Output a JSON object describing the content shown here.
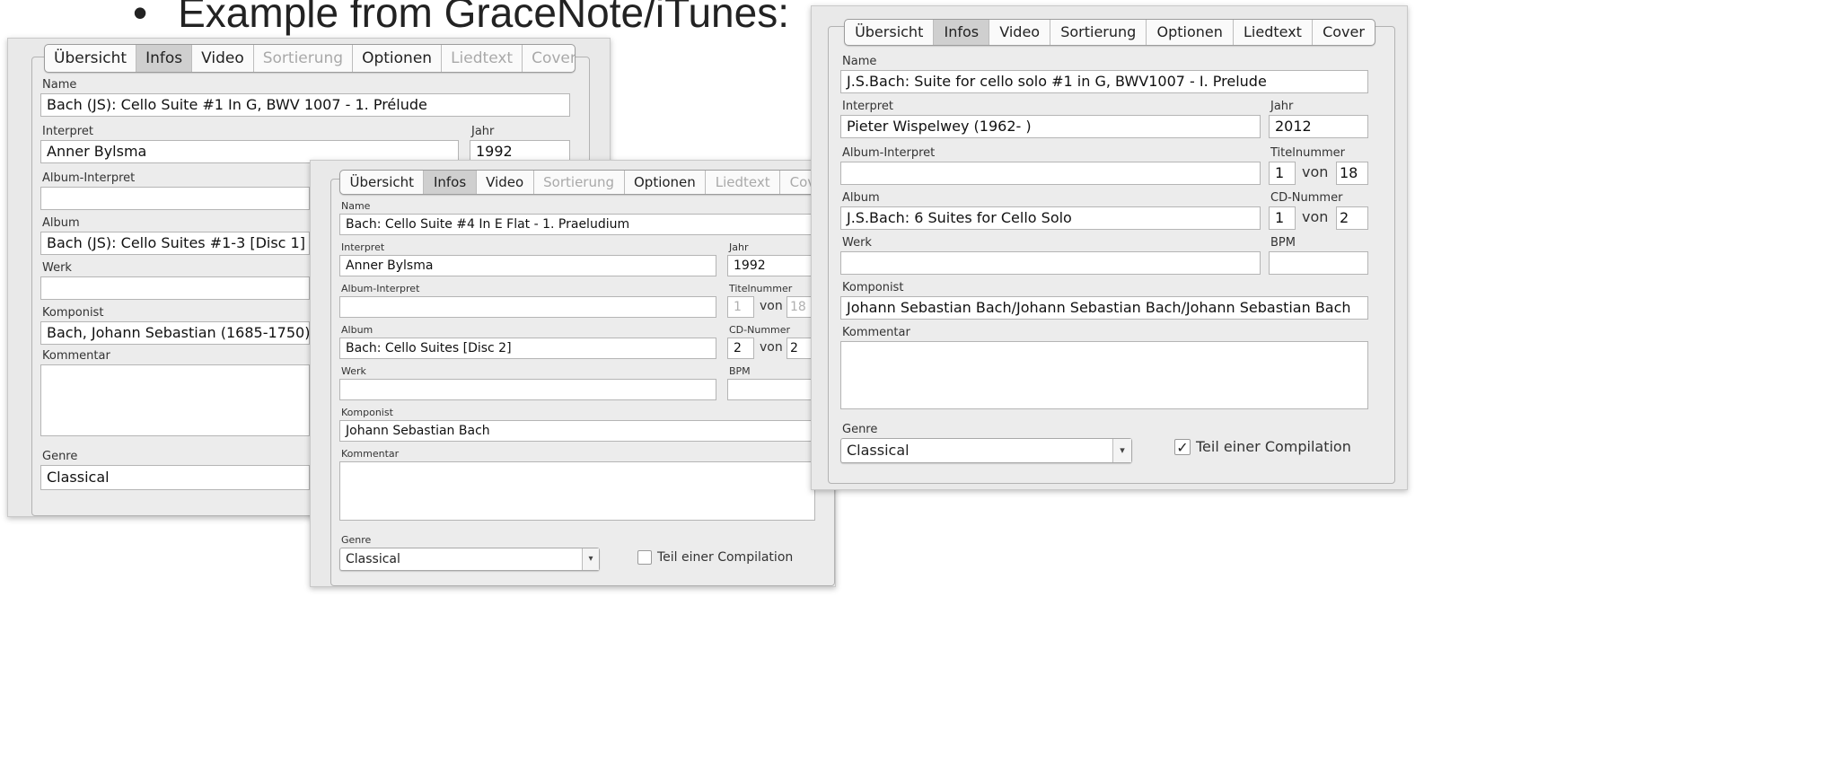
{
  "heading": {
    "bullet": "•",
    "text": "Example from GraceNote/iTunes:"
  },
  "icons": {
    "dropdown": "dropdown-arrow-icon",
    "checkmark": "checkmark-icon"
  },
  "panel1": {
    "tabs": [
      "Übersicht",
      "Infos",
      "Video",
      "Sortierung",
      "Optionen",
      "Liedtext",
      "Cover"
    ],
    "labels": {
      "name": "Name",
      "interpret": "Interpret",
      "jahr": "Jahr",
      "album_interpret": "Album-Interpret",
      "album": "Album",
      "werk": "Werk",
      "komponist": "Komponist",
      "kommentar": "Kommentar",
      "genre": "Genre"
    },
    "values": {
      "name": "Bach (JS): Cello Suite #1 In G, BWV 1007 - 1. Prélude",
      "interpret": "Anner Bylsma",
      "jahr": "1992",
      "album_interpret": "",
      "album": "Bach (JS): Cello Suites #1-3 [Disc 1]",
      "werk": "",
      "komponist": "Bach, Johann Sebastian (1685-1750)",
      "kommentar": "",
      "genre": "Classical"
    }
  },
  "panel2": {
    "tabs": [
      "Übersicht",
      "Infos",
      "Video",
      "Sortierung",
      "Optionen",
      "Liedtext",
      "Cover"
    ],
    "labels": {
      "name": "Name",
      "interpret": "Interpret",
      "jahr": "Jahr",
      "album_interpret": "Album-Interpret",
      "titelnummer": "Titelnummer",
      "album": "Album",
      "cd_nummer": "CD-Nummer",
      "werk": "Werk",
      "bpm": "BPM",
      "komponist": "Komponist",
      "kommentar": "Kommentar",
      "genre": "Genre",
      "von": "von",
      "compilation": "Teil einer Compilation"
    },
    "values": {
      "name": "Bach: Cello Suite #4 In E Flat - 1. Praeludium",
      "interpret": "Anner Bylsma",
      "jahr": "1992",
      "album_interpret": "",
      "track_no": "1",
      "track_total": "18",
      "album": "Bach: Cello Suites [Disc 2]",
      "disc_no": "2",
      "disc_total": "2",
      "werk": "",
      "bpm": "",
      "komponist": "Johann Sebastian Bach",
      "kommentar": "",
      "genre": "Classical",
      "compilation_checked": false,
      "check_mark": ""
    }
  },
  "panel3": {
    "tabs": [
      "Übersicht",
      "Infos",
      "Video",
      "Sortierung",
      "Optionen",
      "Liedtext",
      "Cover"
    ],
    "labels": {
      "name": "Name",
      "interpret": "Interpret",
      "jahr": "Jahr",
      "album_interpret": "Album-Interpret",
      "titelnummer": "Titelnummer",
      "album": "Album",
      "cd_nummer": "CD-Nummer",
      "werk": "Werk",
      "bpm": "BPM",
      "komponist": "Komponist",
      "kommentar": "Kommentar",
      "genre": "Genre",
      "von": "von",
      "compilation": "Teil einer Compilation"
    },
    "values": {
      "name": "J.S.Bach: Suite for cello solo #1 in G, BWV1007 - I. Prelude",
      "interpret": "Pieter Wispelwey (1962- )",
      "jahr": "2012",
      "album_interpret": "",
      "track_no": "1",
      "track_total": "18",
      "album": "J.S.Bach: 6 Suites for Cello Solo",
      "disc_no": "1",
      "disc_total": "2",
      "werk": "",
      "bpm": "",
      "komponist": "Johann Sebastian Bach/Johann Sebastian Bach/Johann Sebastian Bach",
      "kommentar": "",
      "genre": "Classical",
      "compilation_checked": true,
      "check_mark": "✓"
    }
  }
}
